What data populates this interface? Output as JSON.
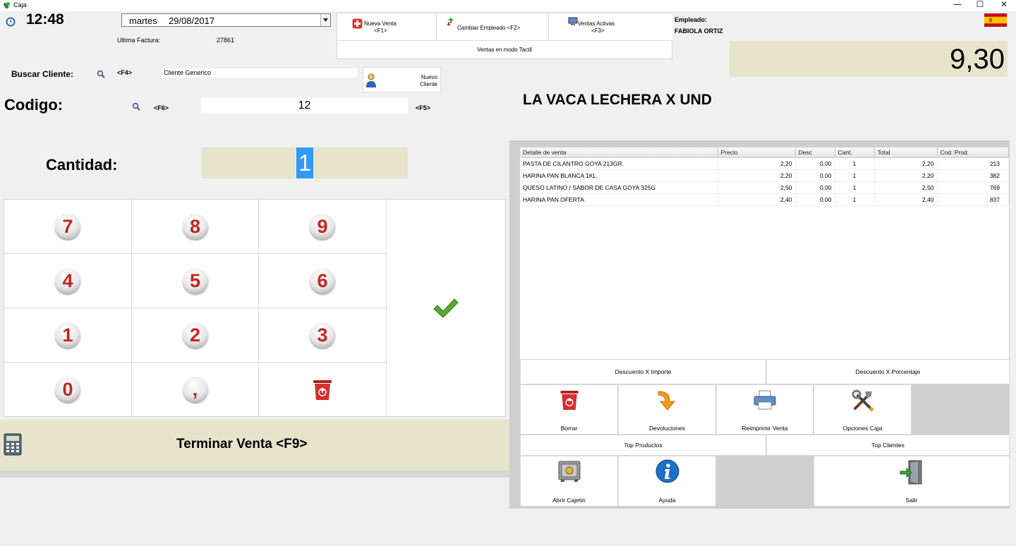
{
  "window": {
    "title": "Caja",
    "minimize": "—",
    "maximize": "☐",
    "close": "✕"
  },
  "header": {
    "time": "12:48",
    "date_day": "martes",
    "date_value": "29/08/2017",
    "last_invoice_label": "Ultima Factura:",
    "last_invoice_value": "27861"
  },
  "toolbar": {
    "new_sale_label": "Nueva Venta",
    "new_sale_key": "<F1>",
    "change_employee_label": "Cambiar Empleado <F2>",
    "active_sales_label": "Ventas Activas",
    "active_sales_key": "<F3>",
    "touch_mode_label": "Ventas en modo Tactil"
  },
  "employee": {
    "label": "Empleado:",
    "name": "FABIOLA ORTIZ"
  },
  "total": "9,30",
  "customer": {
    "label": "Buscar Cliente:",
    "key": "<F4>",
    "value": "Cliente Generico",
    "new_line1": "Nuevo",
    "new_line2": "Cliente"
  },
  "code": {
    "label": "Codigo:",
    "key_search": "<F6>",
    "value": "12",
    "key_add": "<F5>"
  },
  "product_name": "LA VACA LECHERA X UND",
  "quantity": {
    "label": "Cantidad:",
    "value": "1"
  },
  "keypad": {
    "k7": "7",
    "k8": "8",
    "k9": "9",
    "k4": "4",
    "k5": "5",
    "k6": "6",
    "k1": "1",
    "k2": "2",
    "k3": "3",
    "k0": "0",
    "kcomma": ","
  },
  "finish_label": "Terminar Venta <F9>",
  "table": {
    "headers": [
      "Detalle de venta",
      "Precio",
      "Desc",
      "Cant.",
      "Total",
      "Cod. Prod."
    ],
    "rows": [
      [
        "PASTA DE CILANTRO GOYA 213GR.",
        "2,20",
        "0,00",
        "1",
        "2,20",
        "213"
      ],
      [
        "HARINA PAN BLANCA 1KL.",
        "2,20",
        "0,00",
        "1",
        "2,20",
        "382"
      ],
      [
        "QUESO LATINO / SABOR DE CASA GOYA 325G",
        "2,50",
        "0,00",
        "1",
        "2,50",
        "769"
      ],
      [
        "HARINA PAN OFERTA",
        "2,40",
        "0,00",
        "1",
        "2,40",
        "837"
      ]
    ]
  },
  "actions": {
    "discount_amount": "Descuento X Importe",
    "discount_percent": "Descuento X Porcentaje",
    "delete": "Borrar",
    "returns": "Devoluciones",
    "reprint": "Reimprimir Venta",
    "cash_options": "Opciones Caja",
    "top_products": "Top Productos",
    "top_clients": "Top Clientes",
    "open_drawer": "Abrir Cajetin",
    "help": "Ayuda",
    "exit": "Salir"
  },
  "colors": {
    "accent_bg": "#e6e5cc",
    "key_red": "#c2281f",
    "selection_blue": "#3399ff",
    "check_green": "#5aa82e"
  }
}
